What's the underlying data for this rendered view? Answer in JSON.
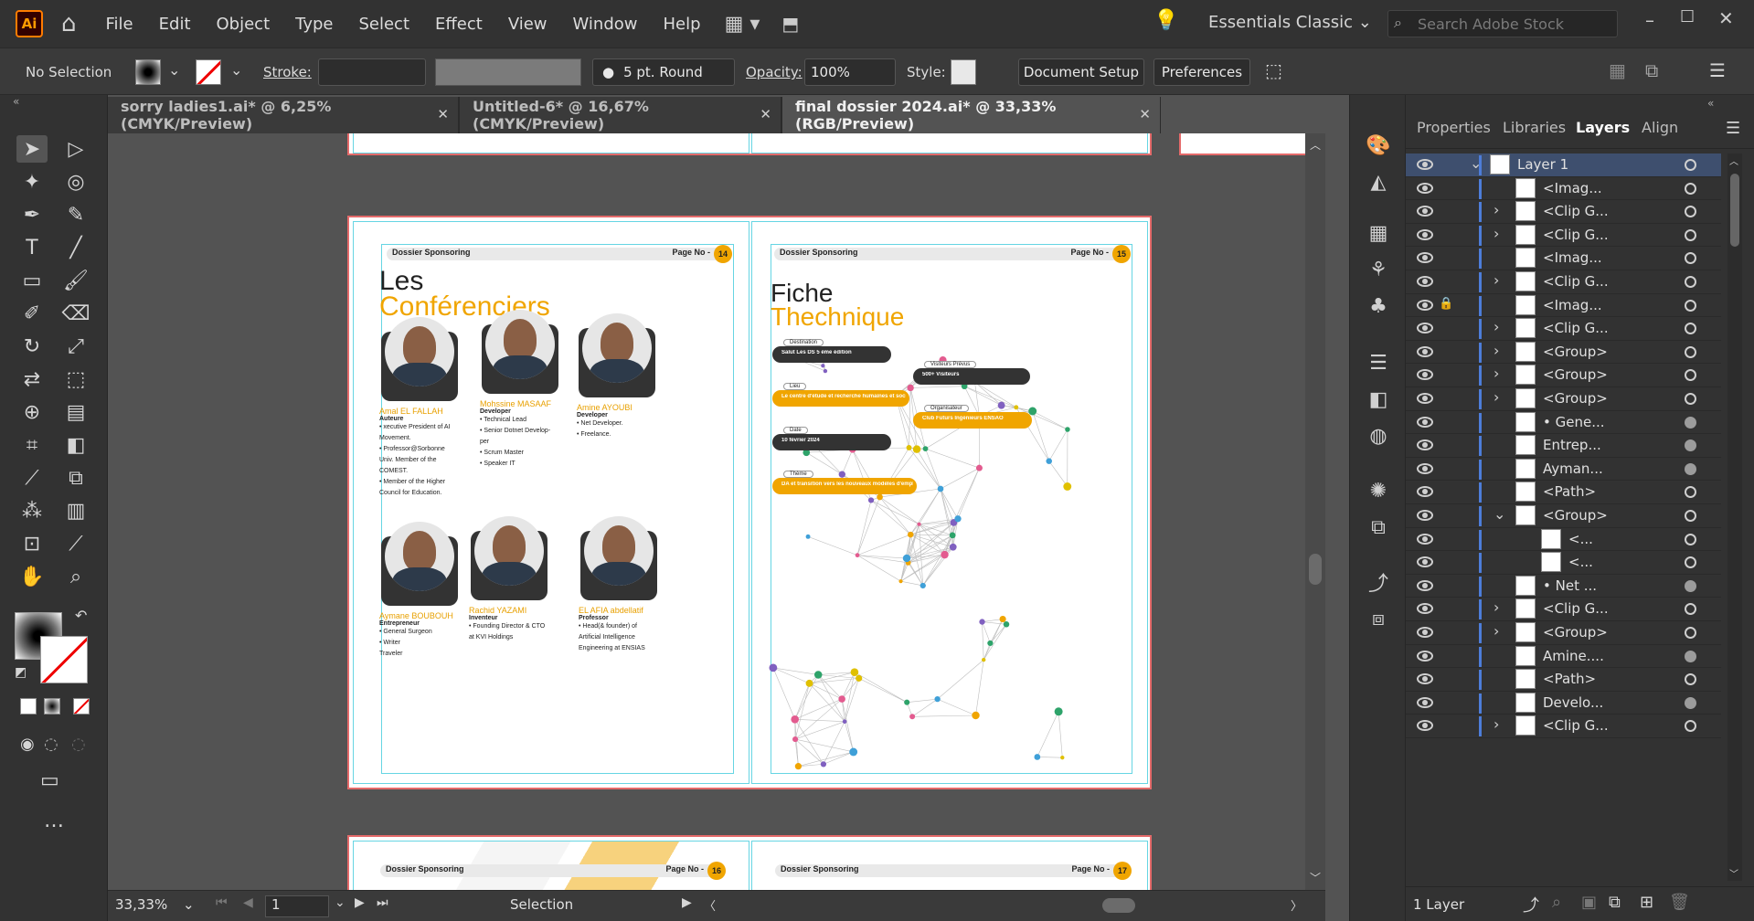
{
  "app": {
    "logo": "Ai",
    "workspace": "Essentials Classic",
    "search_placeholder": "Search Adobe Stock"
  },
  "menu": [
    "File",
    "Edit",
    "Object",
    "Type",
    "Select",
    "Effect",
    "View",
    "Window",
    "Help"
  ],
  "control": {
    "selection_state": "No Selection",
    "stroke_label": "Stroke:",
    "brush_value": "5 pt. Round",
    "opacity_label": "Opacity:",
    "opacity_value": "100%",
    "style_label": "Style:",
    "doc_setup": "Document Setup",
    "preferences": "Preferences"
  },
  "tabs": [
    {
      "label": "sorry ladies1.ai* @ 6,25% (CMYK/Preview)"
    },
    {
      "label": "Untitled-6* @ 16,67% (CMYK/Preview)"
    },
    {
      "label": "final dossier 2024.ai* @ 33,33% (RGB/Preview)"
    }
  ],
  "status": {
    "zoom": "33,33%",
    "artboard": "1",
    "mode": "Selection"
  },
  "panel": {
    "tabs": [
      "Properties",
      "Libraries",
      "Layers",
      "Align"
    ],
    "footer": "1 Layer",
    "layers": [
      {
        "name": "Layer 1",
        "expand": "v"
      },
      {
        "name": "<Imag...",
        "expand": "",
        "target": "o"
      },
      {
        "name": "<Clip G...",
        "expand": ">",
        "target": "o"
      },
      {
        "name": "<Clip G...",
        "expand": ">",
        "target": "o"
      },
      {
        "name": "<Imag...",
        "expand": "",
        "target": "o"
      },
      {
        "name": "<Clip G...",
        "expand": ">",
        "target": "o"
      },
      {
        "name": "<Imag...",
        "expand": "",
        "target": "o",
        "locked": true
      },
      {
        "name": "<Clip G...",
        "expand": ">",
        "target": "o"
      },
      {
        "name": "<Group>",
        "expand": ">",
        "target": "o"
      },
      {
        "name": "<Group>",
        "expand": ">",
        "target": "o"
      },
      {
        "name": "<Group>",
        "expand": ">",
        "target": "o"
      },
      {
        "name": "• Gene...",
        "expand": "",
        "target": "f"
      },
      {
        "name": "Entrep...",
        "expand": "",
        "target": "f"
      },
      {
        "name": "Ayman...",
        "expand": "",
        "target": "f"
      },
      {
        "name": "<Path>",
        "expand": "",
        "target": "o"
      },
      {
        "name": "<Group>",
        "expand": "v",
        "target": "o"
      },
      {
        "name": "<...",
        "expand": "",
        "target": "o",
        "indent": true
      },
      {
        "name": "<...",
        "expand": "",
        "target": "o",
        "indent": true
      },
      {
        "name": "• Net ...",
        "expand": "",
        "target": "f"
      },
      {
        "name": "<Clip G...",
        "expand": ">",
        "target": "o"
      },
      {
        "name": "<Group>",
        "expand": ">",
        "target": "o"
      },
      {
        "name": "Amine....",
        "expand": "",
        "target": "f"
      },
      {
        "name": "<Path>",
        "expand": "",
        "target": "o"
      },
      {
        "name": "Develo...",
        "expand": "",
        "target": "f"
      },
      {
        "name": "<Clip G...",
        "expand": ">",
        "target": "o"
      }
    ]
  },
  "doc": {
    "header_left": "Dossier Sponsoring",
    "page_label": "Page No -",
    "pages": [
      "14",
      "15",
      "16",
      "17"
    ],
    "left_title_1": "Les",
    "left_title_2": "Conférenciers",
    "right_title_1": "Fiche",
    "right_title_2": "Thechnique",
    "speakers": [
      {
        "name": "Amal EL FALLAH",
        "role": "Auteure",
        "lines": [
          "• xecutive President of AI",
          "Movement.",
          "• Professor@Sorbonne",
          "Univ. Member of the",
          "COMEST.",
          "• Member of the Higher",
          "Council for Education."
        ]
      },
      {
        "name": "Mohssine MASAAF",
        "role": "Developer",
        "lines": [
          "• Technical Lead",
          "• Senior Dotnet Develop-",
          "per",
          "• Scrum Master",
          "• Speaker IT"
        ]
      },
      {
        "name": "Amine AYOUBI",
        "role": "Developer",
        "lines": [
          "• Net Developer.",
          "• Freelance."
        ]
      },
      {
        "name": "Aymane BOUBOUH",
        "role": "Entrepreneur",
        "lines": [
          "• General Surgeon",
          "• Writer",
          "Traveler"
        ]
      },
      {
        "name": "Rachid YAZAMI",
        "role": "Inventeur",
        "lines": [
          "• Founding Director & CTO",
          "at KVI Holdings"
        ]
      },
      {
        "name": "EL AFIA abdellatif",
        "role": "Professor",
        "lines": [
          "• Head(& founder) of",
          "Artificial Intelligence",
          "Engineering at ENSIAS"
        ]
      }
    ],
    "fiche": [
      {
        "label": "Destination",
        "value": "Salut Les DS 5 ème édition",
        "style": "dark"
      },
      {
        "label": "Visiteurs Prévus",
        "value": "500+ Visiteurs",
        "style": "dark"
      },
      {
        "label": "Lieu",
        "value": "Le centre d'étude et recherche humaines et sociales d'Oujda",
        "style": "yellow"
      },
      {
        "label": "Organisateur",
        "value": "Club Futurs Ingénieurs ENSAO",
        "style": "yellow"
      },
      {
        "label": "Date",
        "value": "10 février 2024",
        "style": "dark"
      },
      {
        "label": "Thème",
        "value": "DA et transition vers les nouveaux modèles d'emplois",
        "style": "yellow"
      }
    ]
  },
  "colors": {
    "accent": "#f0a500",
    "artboard_border": "#e46a6a",
    "guide": "#66d5e3",
    "dark_pill": "#333333"
  }
}
